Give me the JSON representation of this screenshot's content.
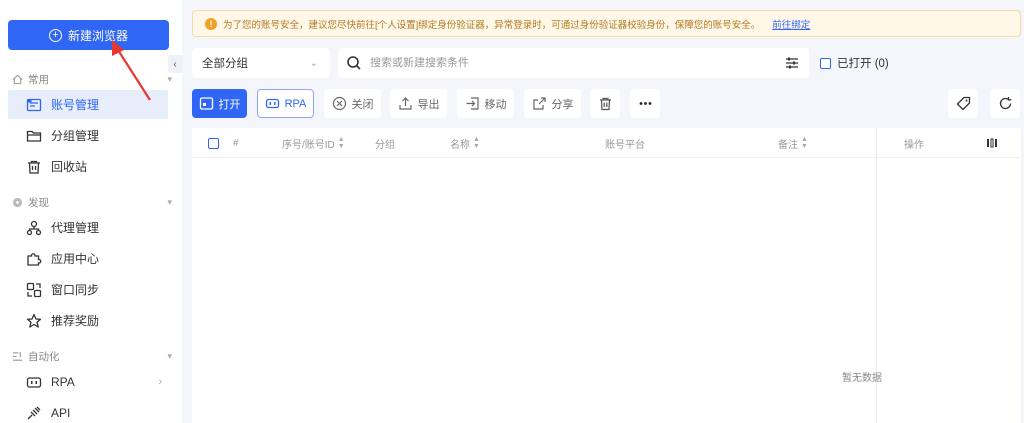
{
  "sidebar": {
    "new_browser_label": "新建浏览器",
    "sections": {
      "common": "常用",
      "discover": "发现",
      "automation": "自动化"
    },
    "items": {
      "accounts": "账号管理",
      "groups": "分组管理",
      "recycle": "回收站",
      "proxy": "代理管理",
      "apps": "应用中心",
      "window_sync": "窗口同步",
      "referral": "推荐奖励",
      "rpa": "RPA",
      "api": "API"
    }
  },
  "notice": {
    "text": "为了您的账号安全，建议您尽快前往[个人设置]绑定身份验证器，异常登录时，可通过身份验证器校验身份，保障您的账号安全。",
    "link": "前往绑定"
  },
  "filter": {
    "group_value": "全部分组",
    "search_placeholder": "搜索或新建搜索条件",
    "opened_label": "已打开 (0)"
  },
  "toolbar": {
    "open": "打开",
    "rpa": "RPA",
    "close": "关闭",
    "export": "导出",
    "move": "移动",
    "share": "分享"
  },
  "table": {
    "columns": {
      "index": "#",
      "id": "序号/账号ID",
      "group": "分组",
      "name": "名称",
      "platform": "账号平台",
      "remark": "备注",
      "actions": "操作"
    },
    "empty_text": "暂无数据"
  },
  "colors": {
    "primary": "#2f66f6",
    "notice_bg": "#fff7e8",
    "notice_border": "#f7d9a3",
    "arrow": "#e8372c"
  }
}
